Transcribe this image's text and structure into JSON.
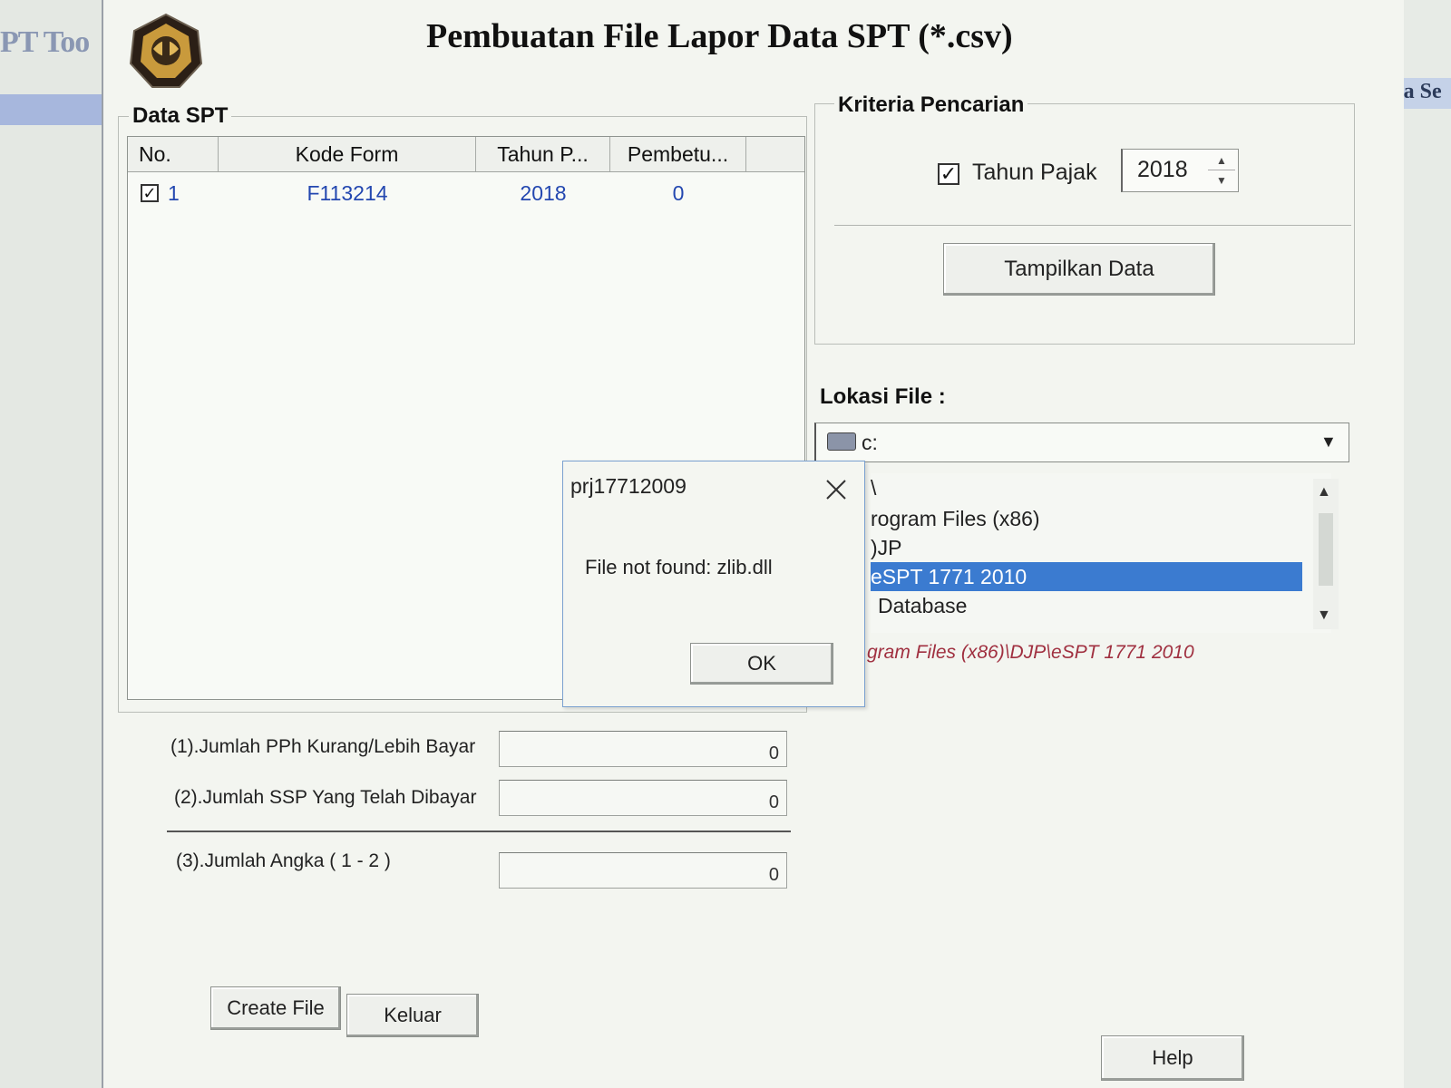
{
  "background": {
    "left_title": "PT Too",
    "right_title": "la Se"
  },
  "window": {
    "title": "Pembuatan File Lapor Data SPT (*.csv)"
  },
  "data_spt": {
    "group_label": "Data SPT",
    "columns": [
      "No.",
      "Kode Form",
      "Tahun P...",
      "Pembetu..."
    ],
    "rows": [
      {
        "checked": true,
        "no": "1",
        "kode_form": "F113214",
        "tahun_pajak": "2018",
        "pembetulan": "0"
      }
    ]
  },
  "summary": {
    "line1_label": "(1).Jumlah PPh Kurang/Lebih Bayar",
    "line1_value": "0",
    "line2_label": "(2).Jumlah SSP Yang Telah Dibayar",
    "line2_value": "0",
    "line3_label": "(3).Jumlah Angka ( 1 - 2 )",
    "line3_value": "0"
  },
  "buttons": {
    "create_file": "Create File",
    "keluar": "Keluar",
    "help": "Help",
    "tampilkan_data": "Tampilkan Data"
  },
  "kriteria": {
    "group_label": "Kriteria Pencarian",
    "tahun_pajak_label": "Tahun Pajak",
    "tahun_pajak_checked": true,
    "tahun_pajak_value": "2018"
  },
  "lokasi": {
    "label": "Lokasi File :",
    "drive": "c:",
    "folders": [
      {
        "label": "\\",
        "selected": false
      },
      {
        "label": "rogram Files (x86)",
        "selected": false
      },
      {
        "label": ")JP",
        "selected": false
      },
      {
        "label": "eSPT 1771 2010",
        "selected": true
      },
      {
        "label": "Database",
        "selected": false
      }
    ],
    "current_path": "gram Files (x86)\\DJP\\eSPT 1771 2010"
  },
  "dialog": {
    "title": "prj17712009",
    "message": "File not found: zlib.dll",
    "ok_label": "OK"
  },
  "colors": {
    "selection": "#3b7bd0",
    "path_text": "#a03040",
    "row_text": "#2347b0"
  }
}
